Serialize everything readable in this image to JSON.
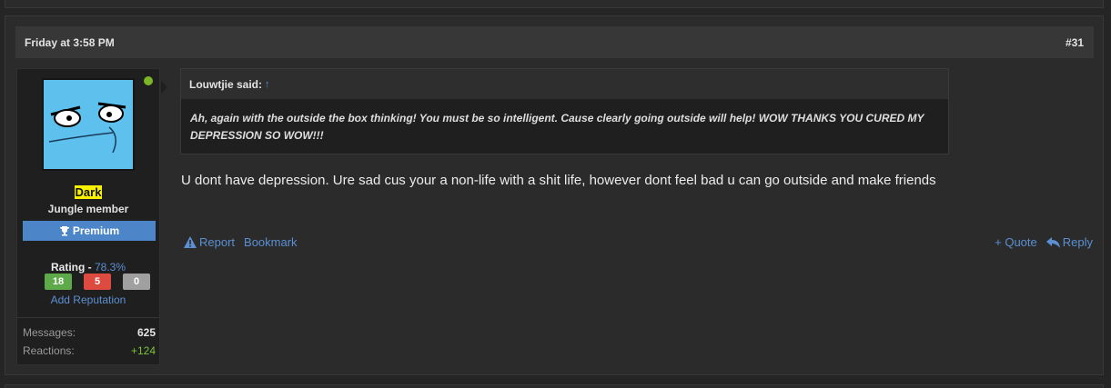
{
  "post": {
    "date": "Friday at 3:58 PM",
    "number": "#31",
    "author": {
      "name": "Dark",
      "title": "Jungle member",
      "badge": "Premium",
      "online": true,
      "rating_label": "Rating - ",
      "rating_value": "78.3%",
      "rep_positive": "18",
      "rep_negative": "5",
      "rep_neutral": "0",
      "add_reputation": "Add Reputation",
      "messages_label": "Messages:",
      "messages_value": "625",
      "reactions_label": "Reactions:",
      "reactions_value": "+124"
    },
    "quote": {
      "author": "Louwtjie said:",
      "arrow": "↑",
      "text": "Ah, again with the outside the box thinking! You must be so intelligent. Cause clearly going outside will help! WOW THANKS YOU CURED MY DEPRESSION SO WOW!!!"
    },
    "body": "U dont have depression. Ure sad cus your a non-life with a shit life, however dont feel bad u can go outside and make friends",
    "actions": {
      "report": "Report",
      "bookmark": "Bookmark",
      "quote": "+ Quote",
      "reply": "Reply"
    }
  },
  "colors": {
    "accent": "#5b8fd2",
    "premium": "#4c86c9",
    "online": "#7cb625",
    "name_highlight": "#f7f100",
    "rep_positive": "#5ea94a",
    "rep_negative": "#dd4a40",
    "rep_neutral": "#a0a0a0"
  }
}
